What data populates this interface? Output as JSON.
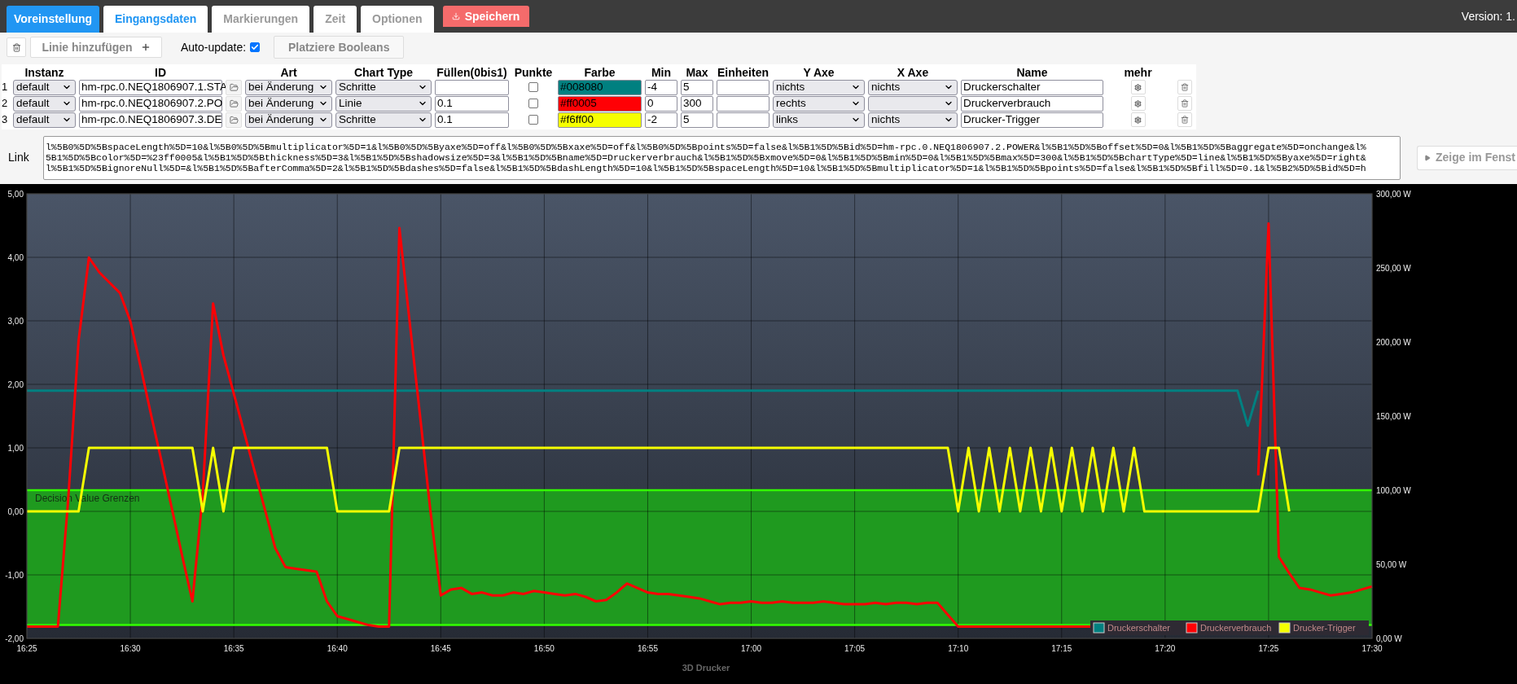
{
  "nav": [
    {
      "label": "Voreinstellung",
      "kind": "primary",
      "selected": false
    },
    {
      "label": "Eingangsdaten",
      "kind": "tab",
      "selected": true
    },
    {
      "label": "Markierungen",
      "kind": "tab",
      "selected": false
    },
    {
      "label": "Zeit",
      "kind": "tab",
      "selected": false
    },
    {
      "label": "Optionen",
      "kind": "tab",
      "selected": false
    },
    {
      "label": "Speichern",
      "kind": "save",
      "selected": false
    }
  ],
  "version": "Version: 1.",
  "toolbar": {
    "add_label": "Linie hinzufügen",
    "auto_update": {
      "label": "Auto-update:",
      "checked": true
    },
    "booleans_label": "Platziere Booleans"
  },
  "table": {
    "columns": [
      "Instanz",
      "ID",
      "Art",
      "Chart Type",
      "Füllen(0bis1)",
      "Punkte",
      "Farbe",
      "Min",
      "Max",
      "Einheiten",
      "Y Axe",
      "X Axe",
      "Name",
      "mehr"
    ],
    "rows": [
      {
        "index": "1",
        "instanz": "default",
        "id": "hm-rpc.0.NEQ1806907.1.STA",
        "art": "bei Änderung",
        "chart_type": "Schritte",
        "points": false,
        "farbe": "#008080",
        "color": "#008080",
        "min": "-4",
        "max": "5",
        "y_axe": "nichts",
        "x_axe": "nichts",
        "name": "Druckerschalter"
      },
      {
        "index": "2",
        "instanz": "default",
        "id": "hm-rpc.0.NEQ1806907.2.PO",
        "art": "bei Änderung",
        "chart_type": "Linie",
        "fill": "0.1",
        "points": false,
        "farbe": "#ff0005",
        "color": "#ff0005",
        "min": "0",
        "max": "300",
        "y_axe": "rechts",
        "name": "Druckerverbrauch"
      },
      {
        "index": "3",
        "instanz": "default",
        "id": "hm-rpc.0.NEQ1806907.3.DE",
        "art": "bei Änderung",
        "chart_type": "Schritte",
        "fill": "0.1",
        "points": false,
        "farbe": "#f6ff00",
        "color": "#f6ff00",
        "min": "-2",
        "max": "5",
        "y_axe": "links",
        "x_axe": "nichts",
        "name": "Drucker-Trigger"
      }
    ]
  },
  "link": {
    "label": "Link",
    "lines": [
      "l%5B0%5D%5BspaceLength%5D=10&l%5B0%5D%5Bmultiplicator%5D=1&l%5B0%5D%5Byaxe%5D=off&l%5B0%5D%5Bxaxe%5D=off&l%5B0%5D%5Bpoints%5D=false&l%5B1%5D%5Bid%5D=hm-rpc.0.NEQ1806907.2.POWER&l%5B1%5D%5Boffset%5D=0&l%5B1%5D%5Baggregate%5D=onchange&l%",
      "5B1%5D%5Bcolor%5D=%23ff0005&l%5B1%5D%5Bthickness%5D=3&l%5B1%5D%5Bshadowsize%5D=3&l%5B1%5D%5Bname%5D=Druckerverbrauch&l%5B1%5D%5Bxmove%5D=0&l%5B1%5D%5Bmin%5D=0&l%5B1%5D%5Bmax%5D=300&l%5B1%5D%5BchartType%5D=line&l%5B1%5D%5Byaxe%5D=right&",
      "l%5B1%5D%5BignoreNull%5D=&l%5B1%5D%5BafterComma%5D=2&l%5B1%5D%5Bdashes%5D=false&l%5B1%5D%5BdashLength%5D=10&l%5B1%5D%5BspaceLength%5D=10&l%5B1%5D%5Bmultiplicator%5D=1&l%5B1%5D%5Bpoints%5D=false&l%5B1%5D%5Bfill%5D=0.1&l%5B2%5D%5Bid%5D=h"
    ],
    "button": "Zeige im Fenst"
  },
  "chart": {
    "chart_data": {
      "type": "line",
      "title": "3D Drucker",
      "grid": true,
      "ylim": [
        -2,
        5
      ],
      "y2lim": [
        0,
        300
      ],
      "bands": [
        {
          "from": 9,
          "to": 100,
          "axis": "y2",
          "label": "Decision Value Grenzen",
          "color": "#1f9a1f"
        }
      ],
      "ref_lines": [
        {
          "value": 100,
          "axis": "y2",
          "color": "#33ff00"
        },
        {
          "value": 9,
          "axis": "y2",
          "color": "#33ff00"
        }
      ],
      "legend": "lower right",
      "categories": [
        "16:25",
        null,
        null,
        null,
        null,
        null,
        null,
        null,
        null,
        null,
        "16:30",
        null,
        null,
        null,
        null,
        null,
        null,
        null,
        null,
        null,
        "16:35",
        null,
        null,
        null,
        null,
        null,
        null,
        null,
        null,
        null,
        "16:40",
        null,
        null,
        null,
        null,
        null,
        null,
        null,
        null,
        null,
        "16:45",
        null,
        null,
        null,
        null,
        null,
        null,
        null,
        null,
        null,
        "16:50",
        null,
        null,
        null,
        null,
        null,
        null,
        null,
        null,
        null,
        "16:55",
        null,
        null,
        null,
        null,
        null,
        null,
        null,
        null,
        null,
        "17:00",
        null,
        null,
        null,
        null,
        null,
        null,
        null,
        null,
        null,
        "17:05",
        null,
        null,
        null,
        null,
        null,
        null,
        null,
        null,
        null,
        "17:10",
        null,
        null,
        null,
        null,
        null,
        null,
        null,
        null,
        null,
        "17:15",
        null,
        null,
        null,
        null,
        null,
        null,
        null,
        null,
        null,
        "17:20",
        null,
        null,
        null,
        null,
        null,
        null,
        null,
        null,
        null,
        "17:25",
        null,
        null,
        null,
        null,
        null,
        null,
        null,
        null,
        null,
        "17:30"
      ],
      "yticks": [
        {
          "value": -2,
          "label": "-2,00"
        },
        {
          "value": -1,
          "label": "-1,00"
        },
        {
          "value": 0,
          "label": "0,00"
        },
        {
          "value": 1,
          "label": "1,00"
        },
        {
          "value": 2,
          "label": "2,00"
        },
        {
          "value": 3,
          "label": "3,00"
        },
        {
          "value": 4,
          "label": "4,00"
        },
        {
          "value": 5,
          "label": "5,00"
        }
      ],
      "y2ticks": [
        {
          "value": 0,
          "label": "0,00 W"
        },
        {
          "value": 50,
          "label": "50,00 W"
        },
        {
          "value": 100,
          "label": "100,00 W"
        },
        {
          "value": 150,
          "label": "150,00 W"
        },
        {
          "value": 200,
          "label": "200,00 W"
        },
        {
          "value": 250,
          "label": "250,00 W"
        },
        {
          "value": 300,
          "label": "300,00 W"
        }
      ],
      "series": [
        {
          "name": "Druckerschalter",
          "color": "#008080",
          "values": [
            1.9,
            1.9,
            1.9,
            1.9,
            1.9,
            1.9,
            1.9,
            1.9,
            1.9,
            1.9,
            1.9,
            1.9,
            1.9,
            1.9,
            1.9,
            1.9,
            1.9,
            1.9,
            1.9,
            1.9,
            1.9,
            1.9,
            1.9,
            1.9,
            1.9,
            1.9,
            1.9,
            1.9,
            1.9,
            1.9,
            1.9,
            1.9,
            1.9,
            1.9,
            1.9,
            1.9,
            1.9,
            1.9,
            1.9,
            1.9,
            1.9,
            1.9,
            1.9,
            1.9,
            1.9,
            1.9,
            1.9,
            1.9,
            1.9,
            1.9,
            1.9,
            1.9,
            1.9,
            1.9,
            1.9,
            1.9,
            1.9,
            1.9,
            1.9,
            1.9,
            1.9,
            1.9,
            1.9,
            1.9,
            1.9,
            1.9,
            1.9,
            1.9,
            1.9,
            1.9,
            1.9,
            1.9,
            1.9,
            1.9,
            1.9,
            1.9,
            1.9,
            1.9,
            1.9,
            1.9,
            1.9,
            1.9,
            1.9,
            1.9,
            1.9,
            1.9,
            1.9,
            1.9,
            1.9,
            1.9,
            1.9,
            1.9,
            1.9,
            1.9,
            1.9,
            1.9,
            1.9,
            1.9,
            1.9,
            1.9,
            1.9,
            1.9,
            1.9,
            1.9,
            1.9,
            1.9,
            1.9,
            1.9,
            1.9,
            1.9,
            1.9,
            1.9,
            1.9,
            1.9,
            1.9,
            1.9,
            1.9,
            1.9,
            1.35,
            1.9,
            null,
            null,
            null,
            null,
            null,
            null,
            null,
            null,
            null,
            null,
            null
          ]
        },
        {
          "name": "Druckerverbrauch",
          "color": "#ff0005",
          "axis": "y2",
          "values": [
            8,
            8,
            8,
            8,
            94,
            201,
            257,
            247,
            240,
            233,
            214,
            183,
            151,
            120,
            88,
            56,
            25,
            97,
            226,
            191,
            165,
            139,
            113,
            87,
            61,
            48,
            47,
            46,
            45,
            25,
            15,
            13,
            11,
            9,
            8,
            8,
            277,
            213,
            150,
            86,
            29,
            33,
            34,
            30,
            31,
            29,
            29,
            31,
            30,
            32,
            31,
            30,
            29,
            30,
            28,
            25,
            26,
            31,
            37,
            34,
            31,
            30,
            30,
            29,
            28,
            27,
            25,
            23,
            24,
            24,
            25,
            24,
            24,
            25,
            24,
            24,
            24,
            25,
            24,
            23,
            23,
            23,
            24,
            23,
            24,
            24,
            23,
            24,
            24,
            16,
            8,
            8,
            8,
            8,
            8,
            8,
            8,
            8,
            8,
            8,
            8,
            8,
            8,
            8,
            null,
            null,
            null,
            null,
            null,
            null,
            null,
            null,
            null,
            null,
            null,
            null,
            null,
            null,
            null,
            110,
            280,
            55,
            44,
            34,
            33,
            31,
            29,
            30,
            31,
            33,
            35
          ]
        },
        {
          "name": "Drucker-Trigger",
          "color": "#f6ff00",
          "values": [
            0,
            0,
            0,
            0,
            0,
            0,
            1,
            1,
            1,
            1,
            1,
            1,
            1,
            1,
            1,
            1,
            1,
            0,
            1,
            0,
            1,
            1,
            1,
            1,
            1,
            1,
            1,
            1,
            1,
            1,
            0,
            0,
            0,
            0,
            0,
            0,
            1,
            1,
            1,
            1,
            1,
            1,
            1,
            1,
            1,
            1,
            1,
            1,
            1,
            1,
            1,
            1,
            1,
            1,
            1,
            1,
            1,
            1,
            1,
            1,
            1,
            1,
            1,
            1,
            1,
            1,
            1,
            1,
            1,
            1,
            1,
            1,
            1,
            1,
            1,
            1,
            1,
            1,
            1,
            1,
            1,
            1,
            1,
            1,
            1,
            1,
            1,
            1,
            1,
            1,
            0,
            1,
            0,
            1,
            0,
            1,
            0,
            1,
            0,
            1,
            0,
            1,
            0,
            1,
            0,
            1,
            0,
            1,
            0,
            0,
            0,
            0,
            0,
            0,
            0,
            0,
            0,
            0,
            0,
            0,
            1,
            1,
            0,
            null,
            null,
            null,
            null,
            null,
            null,
            null,
            null
          ]
        }
      ]
    }
  }
}
